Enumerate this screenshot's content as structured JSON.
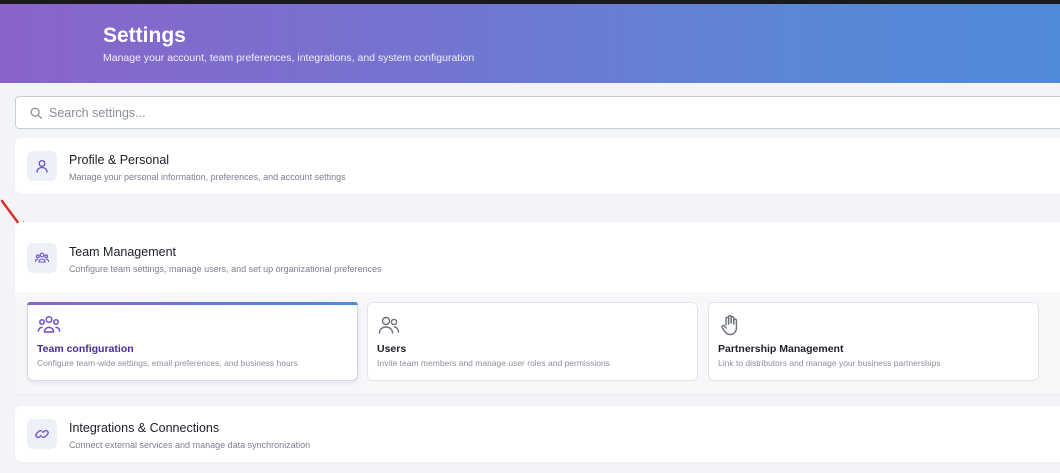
{
  "header": {
    "title": "Settings",
    "subtitle": "Manage your account, team preferences, integrations, and system configuration"
  },
  "search": {
    "placeholder": "Search settings...",
    "icon": "search-icon"
  },
  "sections": {
    "profile": {
      "title": "Profile & Personal",
      "description": "Manage your personal information, preferences, and account settings",
      "icon": "user-icon"
    },
    "team": {
      "title": "Team Management",
      "description": "Configure team settings, manage users, and set up organizational preferences",
      "icon": "team-icon",
      "items": [
        {
          "title": "Team configuration",
          "description": "Configure team-wide settings, email preferences, and business hours",
          "icon": "team-icon",
          "active": true
        },
        {
          "title": "Users",
          "description": "Invite team members and manage user roles and permissions",
          "icon": "users-icon",
          "active": false
        },
        {
          "title": "Partnership Management",
          "description": "Link to distributors and manage your business partnerships",
          "icon": "hand-icon",
          "active": false
        }
      ]
    },
    "integrations": {
      "title": "Integrations & Connections",
      "description": "Connect external services and manage data synchronization",
      "icon": "link-icon"
    }
  },
  "colors": {
    "header_gradient_start": "#8a64c9",
    "header_gradient_end": "#4f8ad8",
    "accent": "#6b4fc9",
    "annotation_arrow": "#d9302b"
  }
}
